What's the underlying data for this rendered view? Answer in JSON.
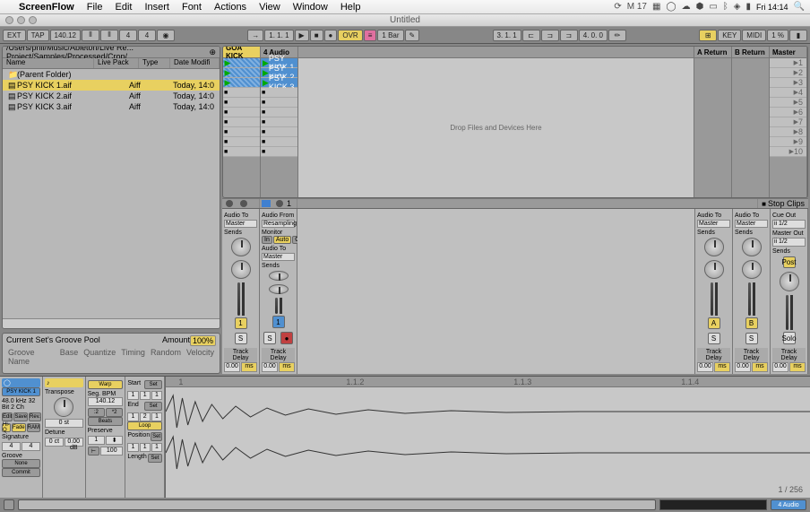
{
  "menubar": {
    "app": "ScreenFlow",
    "items": [
      "File",
      "Edit",
      "Insert",
      "Font",
      "Actions",
      "View",
      "Window",
      "Help"
    ],
    "right": {
      "adobe": "M 17",
      "clock": "Fri 14:14"
    }
  },
  "window": {
    "title": "Untitled"
  },
  "topbar": {
    "ext": "EXT",
    "tap": "TAP",
    "tempo": "140.12",
    "sig1": "4",
    "sig2": "4",
    "pos": "1. 1. 1",
    "ovr": "OVR",
    "bar": "1 Bar",
    "right_nums": "3. 1. 1",
    "right_len": "4. 0. 0",
    "key": "KEY",
    "midi": "MIDI",
    "cpu": "1 %"
  },
  "browser": {
    "path": "/Users/phil/Music/Ableton/Live Re... Project/Samples/Processed/Crop/",
    "cols": {
      "name": "Name",
      "livepack": "Live Pack",
      "type": "Type",
      "date": "Date Modifi"
    },
    "parent": "(Parent Folder)",
    "rows": [
      {
        "name": "PSY KICK 1.aif",
        "type": "Aiff",
        "date": "Today, 14:0"
      },
      {
        "name": "PSY KICK 2.aif",
        "type": "Aiff",
        "date": "Today, 14:0"
      },
      {
        "name": "PSY KICK 3.aif",
        "type": "Aiff",
        "date": "Today, 14:0"
      }
    ]
  },
  "groove": {
    "title": "Current Set's Groove Pool",
    "amount": "Amount",
    "pct": "100%",
    "cols": [
      "Groove Name",
      "Base",
      "Quantize",
      "Timing",
      "Random",
      "Velocity"
    ]
  },
  "session": {
    "trk1": "GOA KICK",
    "trk2": "4 Audio",
    "clips": [
      "PSY KICK 1",
      "PSY KICK 2",
      "PSY KICK 3"
    ],
    "aret": "A Return",
    "bret": "B Return",
    "master": "Master",
    "drop": "Drop Files and Devices Here",
    "scenes": [
      "1",
      "2",
      "3",
      "4",
      "5",
      "6",
      "7",
      "8",
      "9",
      "10"
    ],
    "stop": "Stop Clips"
  },
  "mixer": {
    "audiofrom": "Audio From",
    "resampling": "Resampling",
    "monitor": "Monitor",
    "in": "In",
    "auto": "Auto",
    "off": "Off",
    "audioto": "Audio To",
    "master": "Master",
    "sends": "Sends",
    "cueout": "Cue Out",
    "io12": "ii 1/2",
    "masterout": "Master Out",
    "post": "Post",
    "trackdelay": "Track Delay",
    "delay": "0.00",
    "ms": "ms",
    "one": "1",
    "S": "S",
    "A": "A",
    "B": "B",
    "solo": "Solo"
  },
  "clip": {
    "name": "PSY KICK 1",
    "info": "48.0 kHz 32 Bit 2 Ch",
    "edit": "Edit",
    "save": "Save",
    "rev": "Rev.",
    "hiq": "Hi-Q",
    "fade": "Fade",
    "ram": "RAM",
    "sig": "Signature",
    "sig1": "4",
    "sig2": "4",
    "groovelbl": "Groove",
    "none": "None",
    "commit": "Commit",
    "warp": "Warp",
    "segbpm": "Seg. BPM",
    "bpm": "140.12",
    "half": ":2",
    "dbl": "*2",
    "beats": "Beats",
    "transpose": "Transpose",
    "st": "0 st",
    "detune": "Detune",
    "ct": "0 ct",
    "db": "0.00 dB",
    "start": "Start",
    "set": "Set",
    "end": "End",
    "loop": "Loop",
    "position": "Position",
    "preserve": "Preserve",
    "length": "Length",
    "s1": "1",
    "s2": "1",
    "s3": "1",
    "s4": "2",
    "trp": "100",
    "ruler": [
      "1",
      "1.1.2",
      "1.1.3",
      "1.1.4"
    ],
    "count": "1 / 256"
  },
  "bottom": {
    "label": "4 Audio"
  }
}
